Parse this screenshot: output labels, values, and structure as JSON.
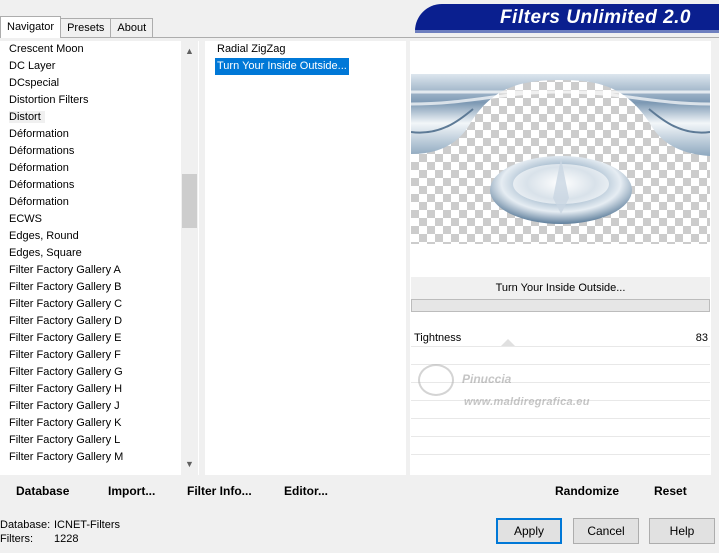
{
  "tabs": [
    "Navigator",
    "Presets",
    "About"
  ],
  "banner_title": "Filters Unlimited 2.0",
  "categories": [
    "Crescent Moon",
    "DC Layer",
    "DCspecial",
    "Distortion Filters",
    "Distort",
    "Déformation",
    "Déformations",
    "Déformation",
    "Déformations",
    "Déformation",
    "ECWS",
    "Edges, Round",
    "Edges, Square",
    "Filter Factory Gallery A",
    "Filter Factory Gallery B",
    "Filter Factory Gallery C",
    "Filter Factory Gallery D",
    "Filter Factory Gallery E",
    "Filter Factory Gallery F",
    "Filter Factory Gallery G",
    "Filter Factory Gallery H",
    "Filter Factory Gallery J",
    "Filter Factory Gallery K",
    "Filter Factory Gallery L",
    "Filter Factory Gallery M"
  ],
  "filters": [
    "Radial ZigZag",
    "Turn Your Inside Outside..."
  ],
  "selected_filter_name": "Turn Your Inside Outside...",
  "parameter": {
    "label": "Tightness",
    "value": "83"
  },
  "watermark": {
    "signature": "Pinuccia",
    "url": "www.maldiregrafica.eu"
  },
  "left_buttons": [
    "Database",
    "Import...",
    "Filter Info...",
    "Editor..."
  ],
  "right_buttons": [
    "Randomize",
    "Reset"
  ],
  "status": {
    "database_label": "Database:",
    "database_value": "ICNET-Filters",
    "filters_label": "Filters:",
    "filters_value": "1228"
  },
  "dialog_buttons": [
    "Apply",
    "Cancel",
    "Help"
  ],
  "colors": {
    "banner": "#0a1f8f",
    "selection": "#0078d7"
  }
}
